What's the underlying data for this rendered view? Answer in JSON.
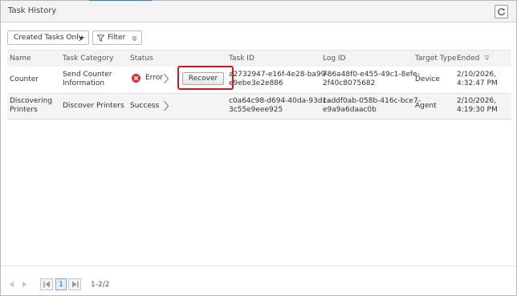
{
  "panel": {
    "title": "Task History",
    "refresh_icon": "refresh-icon"
  },
  "toolbar": {
    "filter_select": {
      "value": "Created Tasks Only"
    },
    "filter_button": {
      "label": "Filter"
    }
  },
  "table": {
    "headers": {
      "name": "Name",
      "task_category": "Task Category",
      "status": "Status",
      "task_id": "Task ID",
      "log_id": "Log ID",
      "target_type": "Target Type",
      "ended": "Ended"
    },
    "rows": [
      {
        "name": "Counter",
        "task_category_line1": "Send Counter",
        "task_category_line2": "Information",
        "status": "Error",
        "action": "Recover",
        "task_id_line1": "a2732947-e16f-4e28-ba99-",
        "task_id_line2": "e9ebe3e2e886",
        "log_id_line1": "786a48f0-e455-49c1-8efe-",
        "log_id_line2": "2f40c8075682",
        "target_type": "Device",
        "ended_line1": "2/10/2026,",
        "ended_line2": "4:32:47 PM"
      },
      {
        "name_line1": "Discovering",
        "name_line2": "Printers",
        "task_category": "Discover Printers",
        "status": "Success",
        "task_id_line1": "c0a64c98-d694-40da-93d1-",
        "task_id_line2": "3c55e9eee925",
        "log_id_line1": "caddf0ab-058b-416c-bce7-",
        "log_id_line2": "e9a9a6daac0b",
        "target_type": "Agent",
        "ended_line1": "2/10/2026,",
        "ended_line2": "4:19:30 PM"
      }
    ]
  },
  "pager": {
    "current_page": "1",
    "range_text": "1-2/2"
  },
  "colors": {
    "accent": "#2e7ac7",
    "error": "#d82c2c",
    "highlight": "#e0141c"
  }
}
